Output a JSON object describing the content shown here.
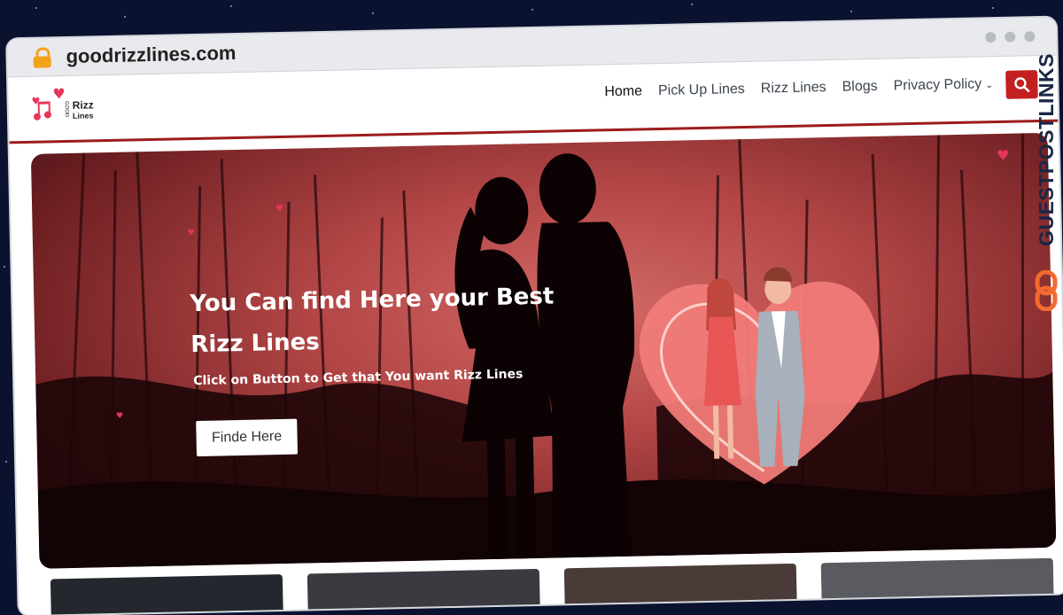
{
  "browser": {
    "url": "goodrizzlines.com"
  },
  "logo": {
    "line1": "Rizz",
    "line2": "Lines",
    "vertical": "GOOD"
  },
  "nav": {
    "items": [
      {
        "label": "Home"
      },
      {
        "label": "Pick Up Lines"
      },
      {
        "label": "Rizz Lines"
      },
      {
        "label": "Blogs"
      },
      {
        "label": "Privacy Policy"
      }
    ]
  },
  "hero": {
    "title_line1": "You Can find Here your Best",
    "title_line2": "Rizz Lines",
    "subtitle": "Click on Button to Get that You want Rizz Lines",
    "button_label": "Finde Here"
  },
  "watermark": {
    "text": "GUESTPOSTLINKS"
  },
  "colors": {
    "brand_red": "#c41f1f",
    "header_rule": "#9e1b1b",
    "lock": "#f4a21c"
  },
  "icons": [
    "lock-icon",
    "search-icon",
    "chevron-down-icon",
    "heart-icon"
  ]
}
